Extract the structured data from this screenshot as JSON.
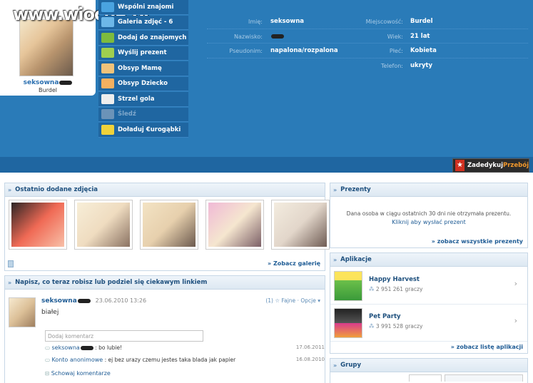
{
  "watermark": "www.wiocha.pl",
  "profile": {
    "name": "seksowna",
    "city": "Burdel"
  },
  "menu": [
    {
      "label": "Wspólni znajomi",
      "icon": "people-icon"
    },
    {
      "label": "Galeria zdjęć - 6",
      "icon": "gallery-icon"
    },
    {
      "label": "Dodaj do znajomych",
      "icon": "add-friend-icon"
    },
    {
      "label": "Wyślij prezent",
      "icon": "gift-icon"
    },
    {
      "label": "Obsyp Mamę",
      "icon": "mom-icon"
    },
    {
      "label": "Obsyp Dziecko",
      "icon": "child-icon"
    },
    {
      "label": "Strzel gola",
      "icon": "football-icon"
    },
    {
      "label": "Śledź",
      "icon": "follow-icon",
      "disabled": true
    },
    {
      "label": "Doładuj €urogąbki",
      "icon": "eurogabki-icon"
    }
  ],
  "details": {
    "left": [
      {
        "label": "Imię:",
        "value": "seksowna"
      },
      {
        "label": "Nazwisko:",
        "value": ""
      },
      {
        "label": "Pseudonim:",
        "value": "napalona/rozpalona"
      }
    ],
    "right": [
      {
        "label": "Miejscowość:",
        "value": "Burdel"
      },
      {
        "label": "Wiek:",
        "value": "21 lat"
      },
      {
        "label": "Płeć:",
        "value": "Kobieta"
      },
      {
        "label": "Telefon:",
        "value": "ukryty"
      }
    ]
  },
  "dedicate": {
    "label": "Zadedykuj",
    "accent": "Przebój"
  },
  "photos_panel": {
    "title": "Ostatnio dodane zdjęcia",
    "see_gallery": "» Zobacz galerię",
    "thumb_colors": [
      "#f06a55",
      "#efdcc0",
      "#e7d0ad",
      "#f0b9d6",
      "#e2d6ca"
    ]
  },
  "share_panel": {
    "title": "Napisz, co teraz robisz lub podziel się ciekawym linkiem",
    "author": "seksowna",
    "date": "23.06.2010 13:26",
    "likes": "(1)",
    "fajne": "Fajne",
    "opcje": "Opcje",
    "status": "białej",
    "comment_placeholder": "Dodaj komentarz",
    "comments": [
      {
        "author": "seksowna",
        "text": ": bo lubie!",
        "date": "17.06.2011"
      },
      {
        "author": "Konto anonimowe",
        "text": ": ej bez urazy czemu jestes taka blada jak papier",
        "date": "16.08.2010"
      }
    ],
    "hide_comments": "Schowaj komentarze"
  },
  "gifts_panel": {
    "title": "Prezenty",
    "message": "Dana osoba w ciągu ostatnich 30 dni nie otrzymała prezentu.",
    "send_link": "Kliknij aby wysłać prezent",
    "see_all": "» zobacz wszystkie prezenty"
  },
  "apps_panel": {
    "title": "Aplikacje",
    "apps": [
      {
        "name": "Happy Harvest",
        "players": "2 951 261 graczy"
      },
      {
        "name": "Pet Party",
        "players": "3 991 528 graczy"
      }
    ],
    "see_list": "» zobacz listę aplikacji"
  },
  "groups_panel": {
    "title": "Grupy"
  }
}
